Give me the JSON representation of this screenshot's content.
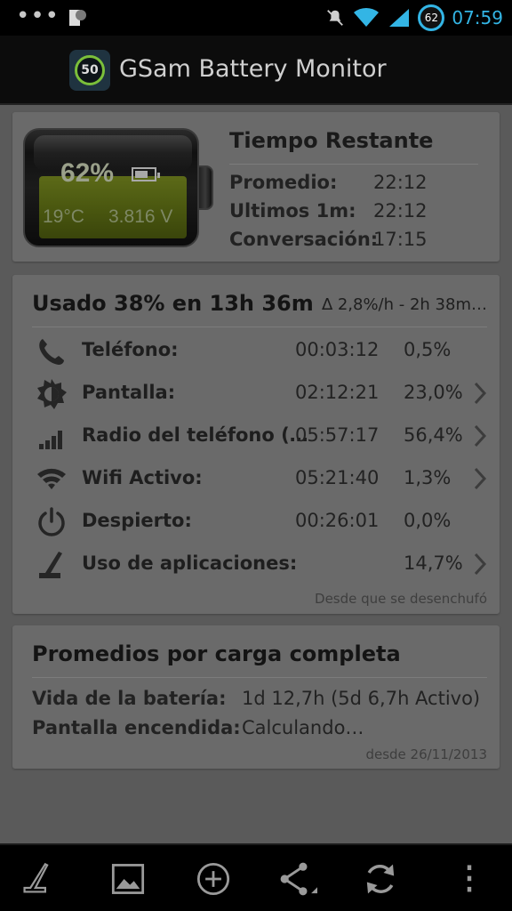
{
  "status_bar": {
    "time": "07:59",
    "battery_level": "62",
    "more_dots": "•••"
  },
  "app": {
    "icon_label": "50",
    "title": "GSam Battery Monitor"
  },
  "battery": {
    "percent": "62%",
    "charge_fraction": 0.62,
    "temperature": "19°C",
    "voltage": "3.816 V",
    "fill_color": "#4e5b11"
  },
  "time_remaining": {
    "title": "Tiempo Restante",
    "rows": [
      {
        "label": "Promedio:",
        "value": "22:12"
      },
      {
        "label": "Ultimos 1m:",
        "value": "22:12"
      },
      {
        "label": "Conversación:",
        "value": "17:15"
      }
    ]
  },
  "usage": {
    "summary": "Usado 38% en 13h 36m",
    "rate": "∆ 2,8%/h - 2h 38m…",
    "rows": [
      {
        "icon": "phone-icon",
        "name": "Teléfono:",
        "duration": "00:03:12",
        "percent": "0,5%",
        "has_detail": false
      },
      {
        "icon": "screen-brightness-icon",
        "name": "Pantalla:",
        "duration": "02:12:21",
        "percent": "23,0%",
        "has_detail": true
      },
      {
        "icon": "signal-bars-icon",
        "name": "Radio del teléfono (…",
        "duration": "05:57:17",
        "percent": "56,4%",
        "has_detail": true
      },
      {
        "icon": "wifi-icon",
        "name": "Wifi Activo:",
        "duration": "05:21:40",
        "percent": "1,3%",
        "has_detail": true
      },
      {
        "icon": "power-icon",
        "name": "Despierto:",
        "duration": "00:26:01",
        "percent": "0,0%",
        "has_detail": false
      },
      {
        "icon": "app-usage-icon",
        "name": "Uso de aplicaciones:",
        "duration": "",
        "percent": "14,7%",
        "has_detail": true
      }
    ],
    "footer": "Desde que se desenchufó"
  },
  "averages": {
    "title": "Promedios por carga completa",
    "rows": [
      {
        "label": "Vida de la batería:",
        "value": "1d 12,7h (5d 6,7h Activo)"
      },
      {
        "label": "Pantalla encendida:",
        "value": "Calculando…"
      }
    ],
    "footer": "desde 26/11/2013"
  },
  "toolbar": {
    "items": [
      "app-usage-icon",
      "image-icon",
      "add-icon",
      "share-icon",
      "refresh-icon",
      "overflow-menu-icon"
    ]
  },
  "colors": {
    "accent": "#33b5e5",
    "card_bg": "#6a6a6a",
    "screen_bg": "#5a5a5a"
  }
}
